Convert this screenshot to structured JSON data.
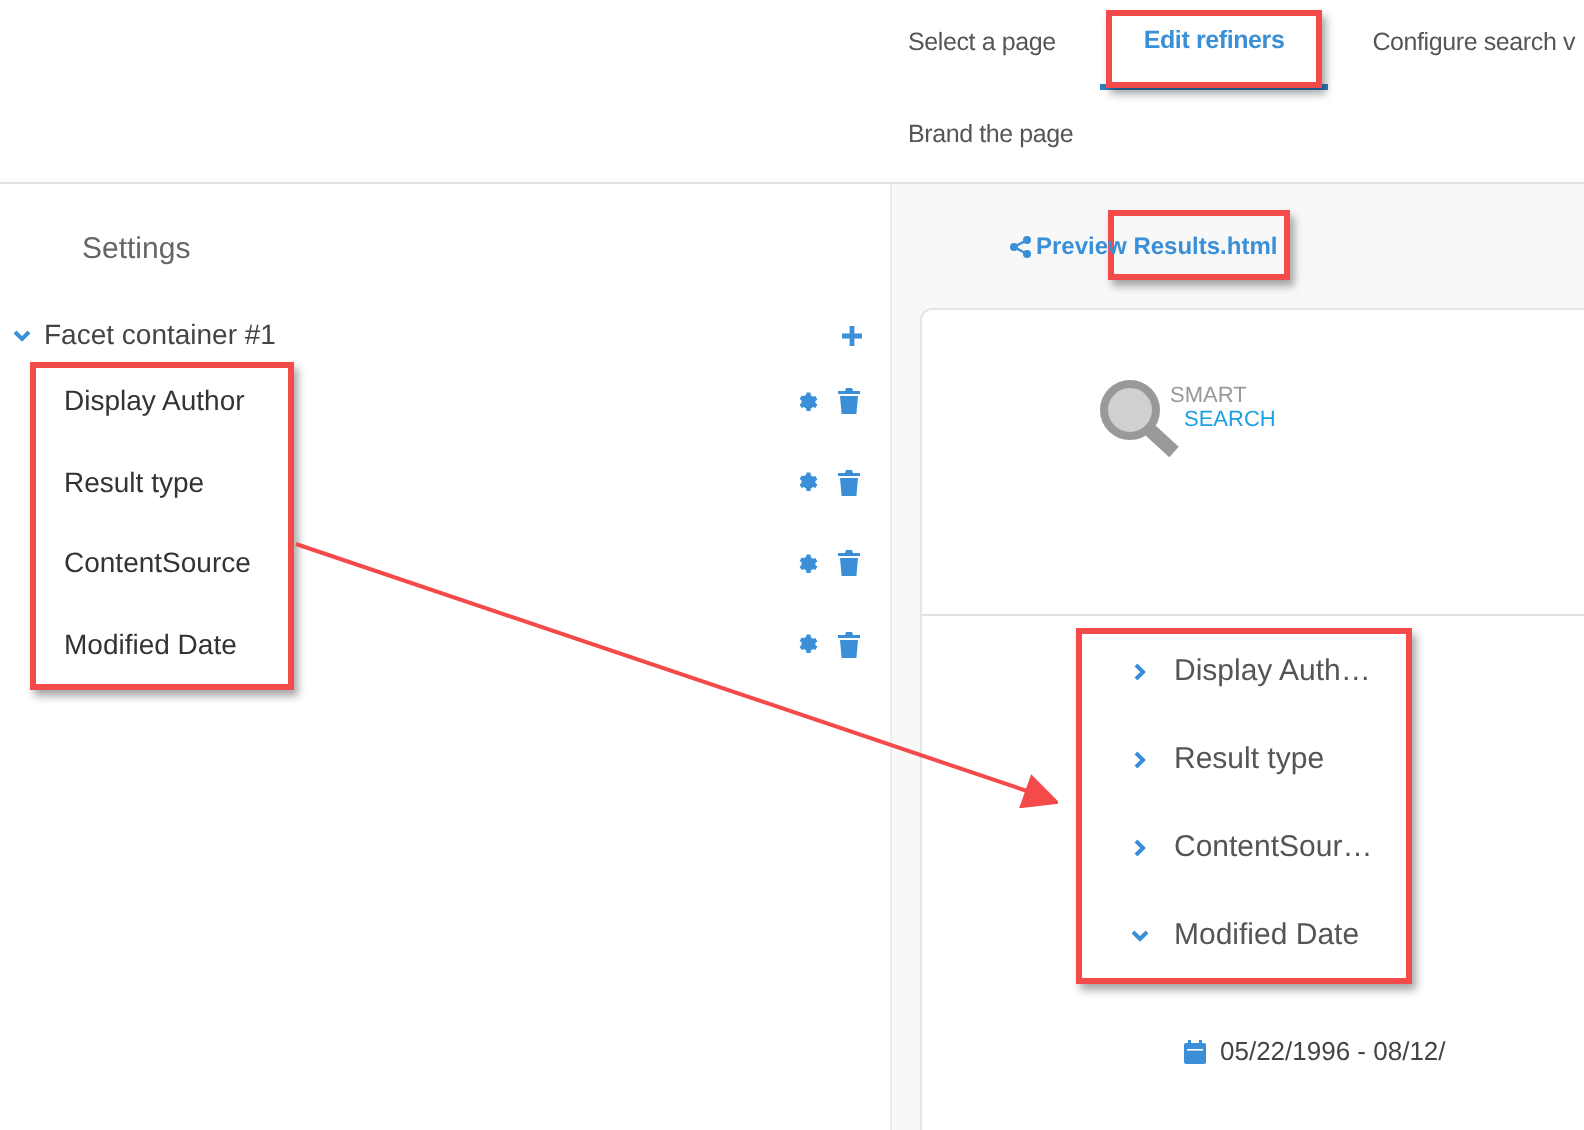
{
  "tabs": [
    {
      "label": "Select a page",
      "selected": false,
      "annotated": false
    },
    {
      "label": "Edit refiners",
      "selected": true,
      "annotated": true
    },
    {
      "label": "Configure search v",
      "selected": false,
      "annotated": false
    },
    {
      "label": "Brand the page",
      "selected": false,
      "annotated": false
    }
  ],
  "settings": {
    "title": "Settings",
    "container": {
      "label": "Facet container #1",
      "expanded": true,
      "annotated": true,
      "items": [
        {
          "label": "Display Author"
        },
        {
          "label": "Result type"
        },
        {
          "label": "ContentSource"
        },
        {
          "label": "Modified Date"
        }
      ]
    }
  },
  "preview": {
    "link": "Preview Results.html",
    "annotated": true,
    "logo": {
      "line_1": "SMART",
      "line_2": "SEARCH"
    },
    "refiners": {
      "annotated": true,
      "items": [
        {
          "label": "Display Auth…",
          "expanded": false
        },
        {
          "label": "Result type",
          "expanded": false
        },
        {
          "label": "ContentSour…",
          "expanded": false
        },
        {
          "label": "Modified Date",
          "expanded": true
        }
      ]
    },
    "date_range": "05/22/1996 - 08/12/"
  },
  "arrow": true
}
